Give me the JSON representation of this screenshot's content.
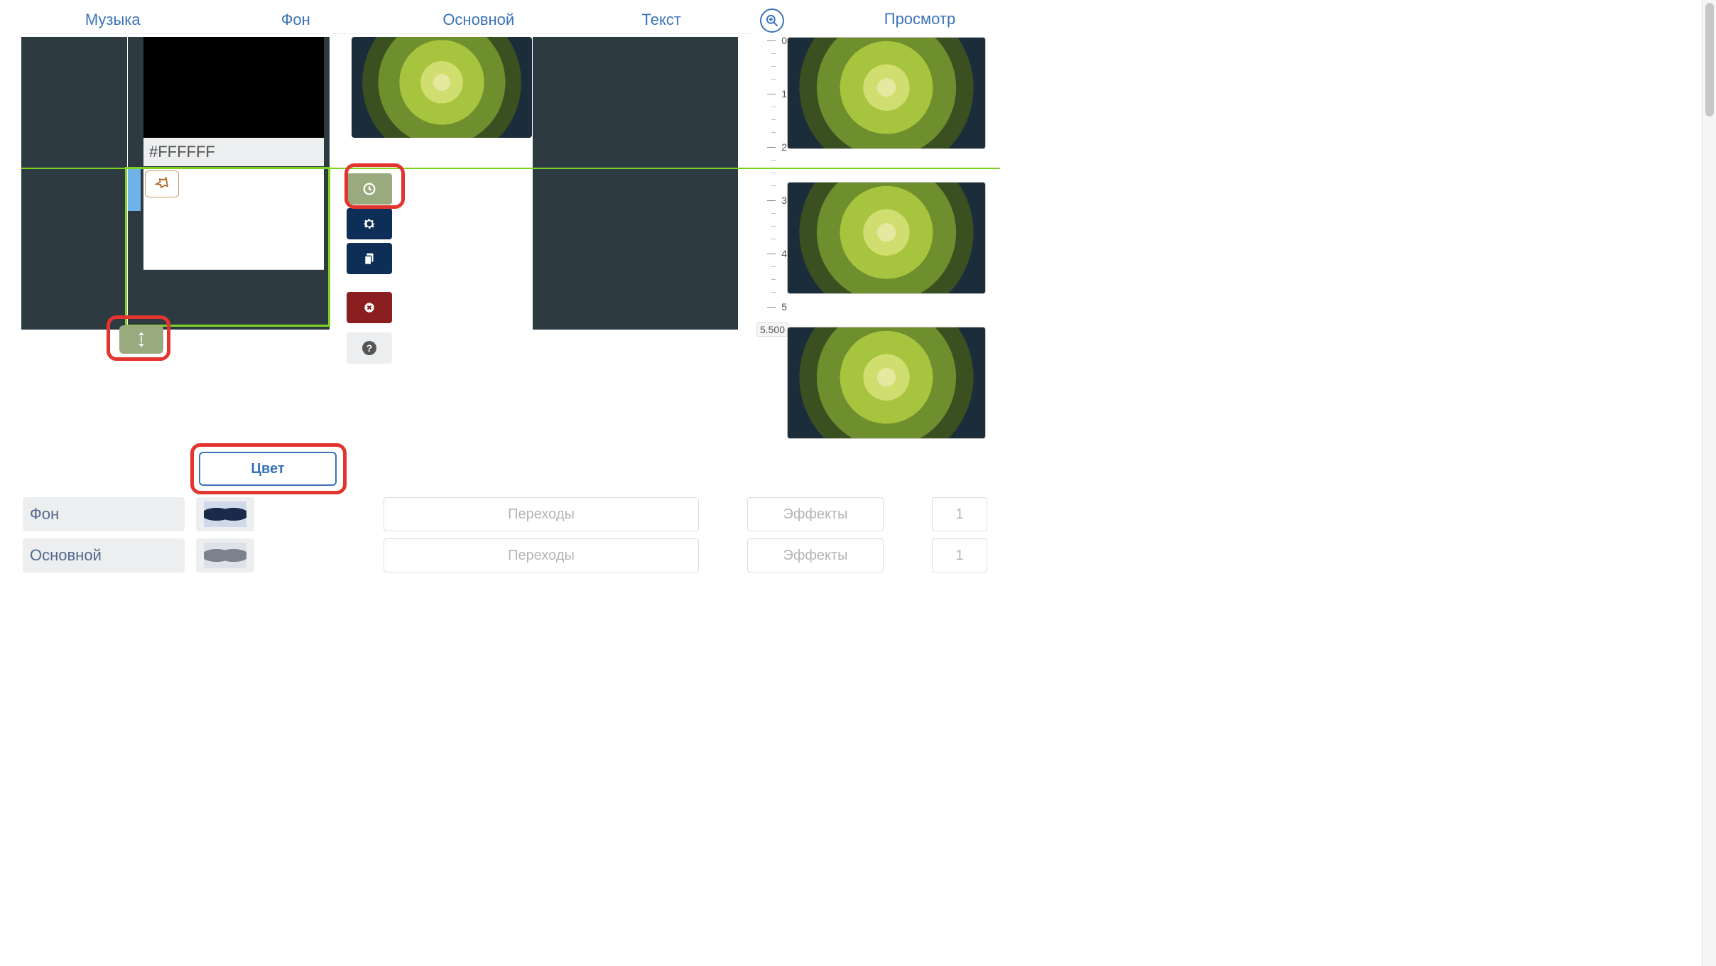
{
  "tabs": {
    "music": "Музыка",
    "background": "Фон",
    "main": "Основной",
    "text": "Текст"
  },
  "preview_label": "Просмотр",
  "bg_color_value": "#FFFFFF",
  "ruler": {
    "ticks": [
      "0",
      "1",
      "2",
      "3",
      "4",
      "5"
    ],
    "end": "5.500"
  },
  "color_button": "Цвет",
  "layers": [
    {
      "name": "Фон",
      "transitions": "Переходы",
      "effects": "Эффекты",
      "count": "1"
    },
    {
      "name": "Основной",
      "transitions": "Переходы",
      "effects": "Эффекты",
      "count": "1"
    }
  ],
  "icons": {
    "zoom": "zoom-in-icon",
    "pin": "pin-icon",
    "clock": "clock-icon",
    "gear": "gear-icon",
    "copy": "copy-icon",
    "delete": "delete-icon",
    "help": "help-icon",
    "resize": "resize-vertical-icon"
  }
}
